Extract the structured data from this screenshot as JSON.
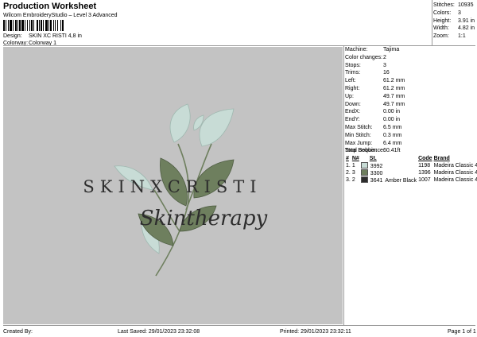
{
  "header": {
    "title": "Production Worksheet",
    "subtitle": "Wilcom EmbroideryStudio – Level 3 Advanced",
    "design_label": "Design:",
    "design_value": "SKIN XC RISTI 4,8 in",
    "colorway_label": "Colorway:",
    "colorway_value": "Colorway 1"
  },
  "top_stats": [
    {
      "label": "Stitches:",
      "value": "10935"
    },
    {
      "label": "Colors:",
      "value": "3"
    },
    {
      "label": "Height:",
      "value": "3.91 in"
    },
    {
      "label": "Width:",
      "value": "4.82 in"
    },
    {
      "label": "Zoom:",
      "value": "1:1"
    }
  ],
  "specs": [
    {
      "label": "Machine:",
      "value": "Tajima"
    },
    {
      "label": "Color changes:",
      "value": "2"
    },
    {
      "label": "Stops:",
      "value": "3"
    },
    {
      "label": "Trims:",
      "value": "16"
    },
    {
      "label": "Left:",
      "value": "61.2 mm"
    },
    {
      "label": "Right:",
      "value": "61.2 mm"
    },
    {
      "label": "Up:",
      "value": "49.7 mm"
    },
    {
      "label": "Down:",
      "value": "49.7 mm"
    },
    {
      "label": "EndX:",
      "value": "0.00 in"
    },
    {
      "label": "EndY:",
      "value": "0.00 in"
    },
    {
      "label": "Max Stitch:",
      "value": "6.5 mm"
    },
    {
      "label": "Min Stitch:",
      "value": "0.3 mm"
    },
    {
      "label": "Max Jump:",
      "value": "6.4 mm"
    },
    {
      "label": "Total Bobbin:",
      "value": "60.41ft"
    }
  ],
  "stop_sequence": {
    "title": "Stop Sequence:",
    "headers": [
      "#",
      "N#",
      "St.",
      "Code",
      "Brand"
    ],
    "rows": [
      {
        "num": "1.",
        "n": "1",
        "color": "#c8dcd6",
        "st": "3992",
        "name": "",
        "stitches": "1198",
        "brand": "Madeira Classic 40"
      },
      {
        "num": "2.",
        "n": "3",
        "color": "#6e7f5e",
        "st": "3300",
        "name": "",
        "stitches": "1396",
        "brand": "Madeira Classic 40"
      },
      {
        "num": "3.",
        "n": "2",
        "color": "#2c2c2c",
        "st": "3641",
        "name": "Amber Black",
        "stitches": "1007",
        "brand": "Madeira Classic 40"
      }
    ]
  },
  "design_preview": {
    "brand_text": "SKINXCRISTI",
    "script_text": "Skintherapy",
    "colors": {
      "light_leaf": "#c8dcd6",
      "dark_leaf": "#6e7f5e",
      "text": "#2c2c2c"
    }
  },
  "footer": {
    "created_by": "Created By:",
    "last_saved": "Last Saved: 29/01/2023 23:32:08",
    "printed": "Printed: 29/01/2023 23:32:11",
    "page": "Page 1 of 1"
  }
}
